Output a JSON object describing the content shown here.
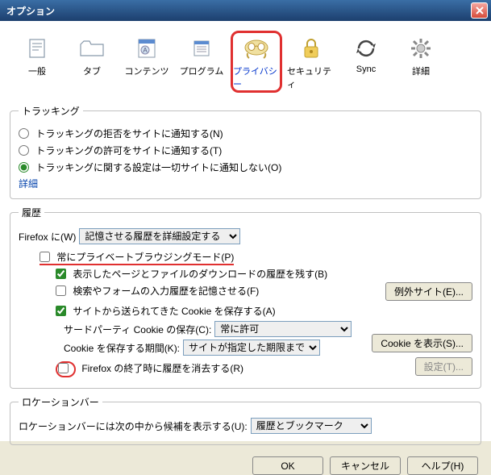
{
  "window": {
    "title": "オプション"
  },
  "tabs": {
    "general": "一般",
    "tab": "タブ",
    "content": "コンテンツ",
    "programs": "プログラム",
    "privacy": "プライバシー",
    "security": "セキュリティ",
    "sync": "Sync",
    "advanced": "詳細"
  },
  "tracking": {
    "legend": "トラッキング",
    "opt1": "トラッキングの拒否をサイトに通知する(N)",
    "opt2": "トラッキングの許可をサイトに通知する(T)",
    "opt3": "トラッキングに関する設定は一切サイトに通知しない(O)",
    "detail": "詳細"
  },
  "history": {
    "legend": "履歴",
    "firefox_label": "Firefox に(W)",
    "firefox_select": "記憶させる履歴を詳細設定する",
    "private_mode": "常にプライベートブラウジングモード(P)",
    "remember_visits": "表示したページとファイルのダウンロードの履歴を残す(B)",
    "remember_forms": "検索やフォームの入力履歴を記憶させる(F)",
    "accept_cookies": "サイトから送られてきた Cookie を保存する(A)",
    "thirdparty_label": "サードパーティ Cookie の保存(C):",
    "thirdparty_value": "常に許可",
    "keep_until_label": "Cookie を保存する期間(K):",
    "keep_until_value": "サイトが指定した期限まで",
    "clear_on_close": "Firefox の終了時に履歴を消去する(R)",
    "exceptions_btn": "例外サイト(E)...",
    "show_cookies_btn": "Cookie を表示(S)...",
    "settings_btn": "設定(T)..."
  },
  "locationbar": {
    "legend": "ロケーションバー",
    "label": "ロケーションバーには次の中から候補を表示する(U):",
    "value": "履歴とブックマーク"
  },
  "buttons": {
    "ok": "OK",
    "cancel": "キャンセル",
    "help": "ヘルプ(H)"
  }
}
